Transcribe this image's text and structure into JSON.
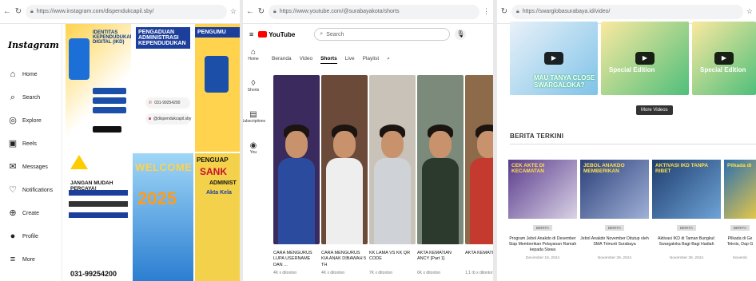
{
  "instagram": {
    "url": "https://www.instagram.com/dispendukcapil.sby/",
    "logo": "Instagram",
    "nav": [
      {
        "label": "Home",
        "icon": "home-icon",
        "glyph": "⌂"
      },
      {
        "label": "Search",
        "icon": "search-icon",
        "glyph": "⌕"
      },
      {
        "label": "Explore",
        "icon": "compass-icon",
        "glyph": "◎"
      },
      {
        "label": "Reels",
        "icon": "reels-icon",
        "glyph": "▣"
      },
      {
        "label": "Messages",
        "icon": "messenger-icon",
        "glyph": "✉"
      },
      {
        "label": "Notifications",
        "icon": "heart-icon",
        "glyph": "♡"
      },
      {
        "label": "Create",
        "icon": "plus-icon",
        "glyph": "⊕"
      },
      {
        "label": "Profile",
        "icon": "avatar-icon",
        "glyph": "●"
      },
      {
        "label": "More",
        "icon": "menu-icon",
        "glyph": "≡"
      }
    ],
    "posts": {
      "p1_title": "IDENTITAS KEPENDUDUKAN DIGITAL (IKD)",
      "p2_title": "PENGADUAN ADMINISTRASI KEPENDUDUKAN",
      "p2_phone": "031-99254200",
      "p2_ig": "@dispendukcapil.sby",
      "p3_title": "PENGUMU",
      "p4_title": "JANGAN MUDAH PERCAYA!",
      "p4_phone": "031-99254200",
      "p5_title": "WELCOME",
      "p5_year": "2025",
      "p6_title": "PENGUAP",
      "p6_sank": "SANK",
      "p6_admin": "ADMINIST",
      "p6_akta": "Akta Kela"
    }
  },
  "youtube": {
    "url": "https://www.youtube.com/@surabayakota/shorts",
    "logo": "YouTube",
    "search_value": "Search",
    "sidebar": [
      {
        "label": "Home",
        "glyph": "⌂"
      },
      {
        "label": "Shorts",
        "glyph": "◊"
      },
      {
        "label": "Subscriptions",
        "glyph": "▤"
      },
      {
        "label": "You",
        "glyph": "◉"
      }
    ],
    "tabs": [
      "Beranda",
      "Video",
      "Shorts",
      "Live",
      "Playlist"
    ],
    "shorts": [
      {
        "title": "CARA MENGURUS LUPA USERNAME DAN ...",
        "views": "4K x ditonton",
        "bg": "#3a2a5e",
        "body": "#2b4c9e"
      },
      {
        "title": "CARA MENGURUS KIA ANAK DIBAWAH 5 TH",
        "views": "4K x ditonton",
        "bg": "#6b4a3a",
        "body": "#eeeeee"
      },
      {
        "title": "KK LAMA VS KK QR CODE",
        "views": "7K x ditonton",
        "bg": "#c9c2b8",
        "body": "#cfd2d6"
      },
      {
        "title": "AKTA KEMATIAN ANCY [Part 1]",
        "views": "6K x ditonton",
        "bg": "#7b8a7a",
        "body": "#2c3a2e"
      },
      {
        "title": "AKTA KEMATI Part 1",
        "views": "1,1 rb x ditonton",
        "bg": "#8c6a4a",
        "body": "#c43a2f"
      }
    ]
  },
  "news": {
    "url": "https://swarglobasurabaya.id/video/",
    "featured": [
      {
        "caption": "MAU TANYA CLOSE SWARGALOKA?",
        "bg": "linear-gradient(135deg,#e9f1f9,#7fc3e8)"
      },
      {
        "caption": "Special Edition",
        "bg": "linear-gradient(135deg,#fbe9a0,#4fbf7b)"
      },
      {
        "caption": "Special Edition",
        "bg": "linear-gradient(135deg,#fbe9a0,#4fbf7b)"
      }
    ],
    "more_button": "More Videos",
    "section_title": "BERITA TERKINI",
    "articles": [
      {
        "headline": "CEK AKTE DI KECAMATAN",
        "tag": "BERITA",
        "title": "Program Jebol Anakdo di Desember Siap Memberikan Pelayanan Ramah kepada Siswa",
        "date": "December 19, 2024",
        "bg": "linear-gradient(135deg,#5a3b8c,#d9d3e6)"
      },
      {
        "headline": "JEBOL ANAKDO MEMBERIKAN",
        "tag": "BERITA",
        "title": "Jebol Anakdo November Ditutup oleh SMA Trimurti Surabaya",
        "date": "November 29, 2024",
        "bg": "linear-gradient(135deg,#2c3f7a,#9fb1d6)"
      },
      {
        "headline": "AKTIVASI IKD TANPA RIBET",
        "tag": "BERITA",
        "title": "Aktivasi IKD di Taman Bungkul: Swargaloka Bagi-Bagi Hadiah",
        "date": "November 28, 2024",
        "bg": "linear-gradient(135deg,#1e3d6e,#6fa3d6)"
      },
      {
        "headline": "Pilkada di",
        "tag": "BERITA",
        "title": "Pilkada di Ge Teknis, Dap G",
        "date": "Novemb",
        "bg": "linear-gradient(135deg,#2b6fb0,#e3c74a)"
      }
    ]
  }
}
